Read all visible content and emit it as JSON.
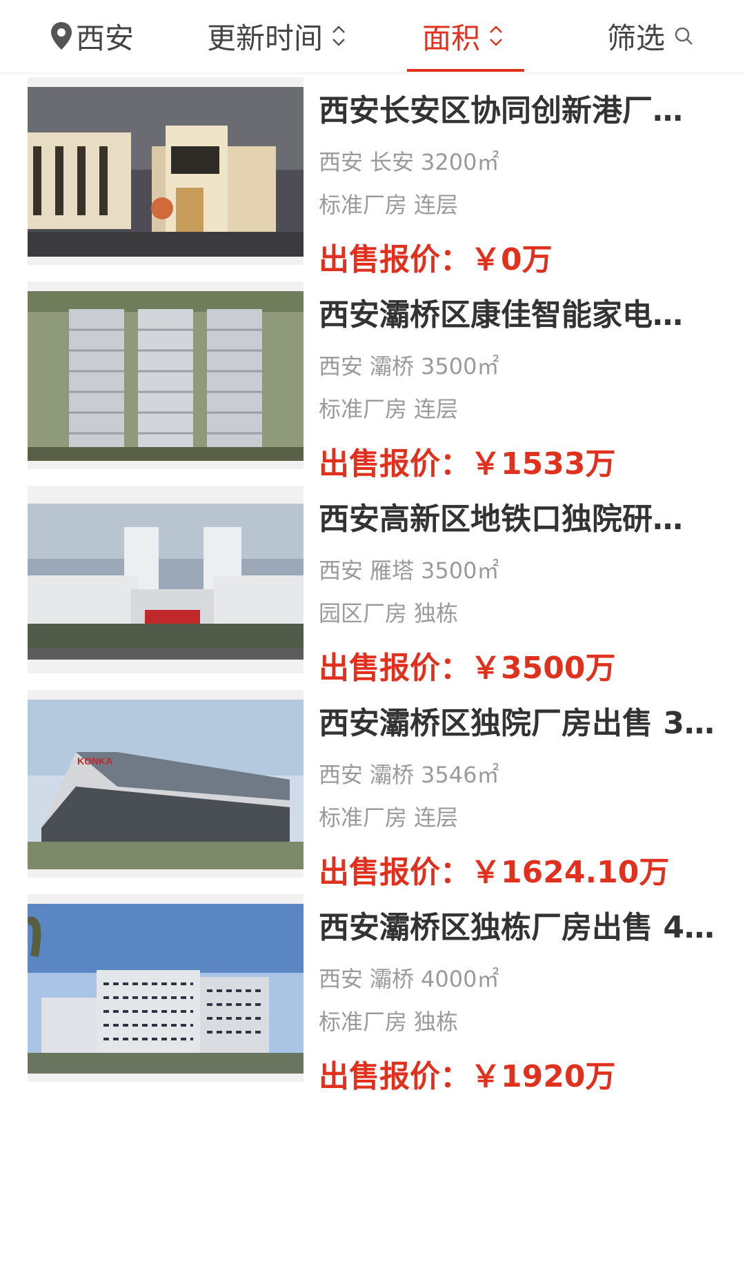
{
  "filter_bar": {
    "city": "西安",
    "update_time": "更新时间",
    "area": "面积",
    "filter": "筛选"
  },
  "listings": [
    {
      "title": "西安长安区协同创新港厂…",
      "city": "西安",
      "district": "长安",
      "area": "3200㎡",
      "type": "标准厂房",
      "structure": "连层",
      "price_label": "出售报价：",
      "price_value": "￥0万"
    },
    {
      "title": "西安灞桥区康佳智能家电…",
      "city": "西安",
      "district": "灞桥",
      "area": "3500㎡",
      "type": "标准厂房",
      "structure": "连层",
      "price_label": "出售报价：",
      "price_value": "￥1533万"
    },
    {
      "title": "西安高新区地铁口独院研…",
      "city": "西安",
      "district": "雁塔",
      "area": "3500㎡",
      "type": "园区厂房",
      "structure": "独栋",
      "price_label": "出售报价：",
      "price_value": "￥3500万"
    },
    {
      "title": "西安灞桥区独院厂房出售 3…",
      "city": "西安",
      "district": "灞桥",
      "area": "3546㎡",
      "type": "标准厂房",
      "structure": "连层",
      "price_label": "出售报价：",
      "price_value": "￥1624.10万"
    },
    {
      "title": "西安灞桥区独栋厂房出售 4…",
      "city": "西安",
      "district": "灞桥",
      "area": "4000㎡",
      "type": "标准厂房",
      "structure": "独栋",
      "price_label": "出售报价：",
      "price_value": "￥1920万"
    }
  ],
  "logo_text": "KONKA",
  "colors": {
    "accent": "#e0301e",
    "title": "#333333",
    "meta": "#9a9a9a"
  }
}
